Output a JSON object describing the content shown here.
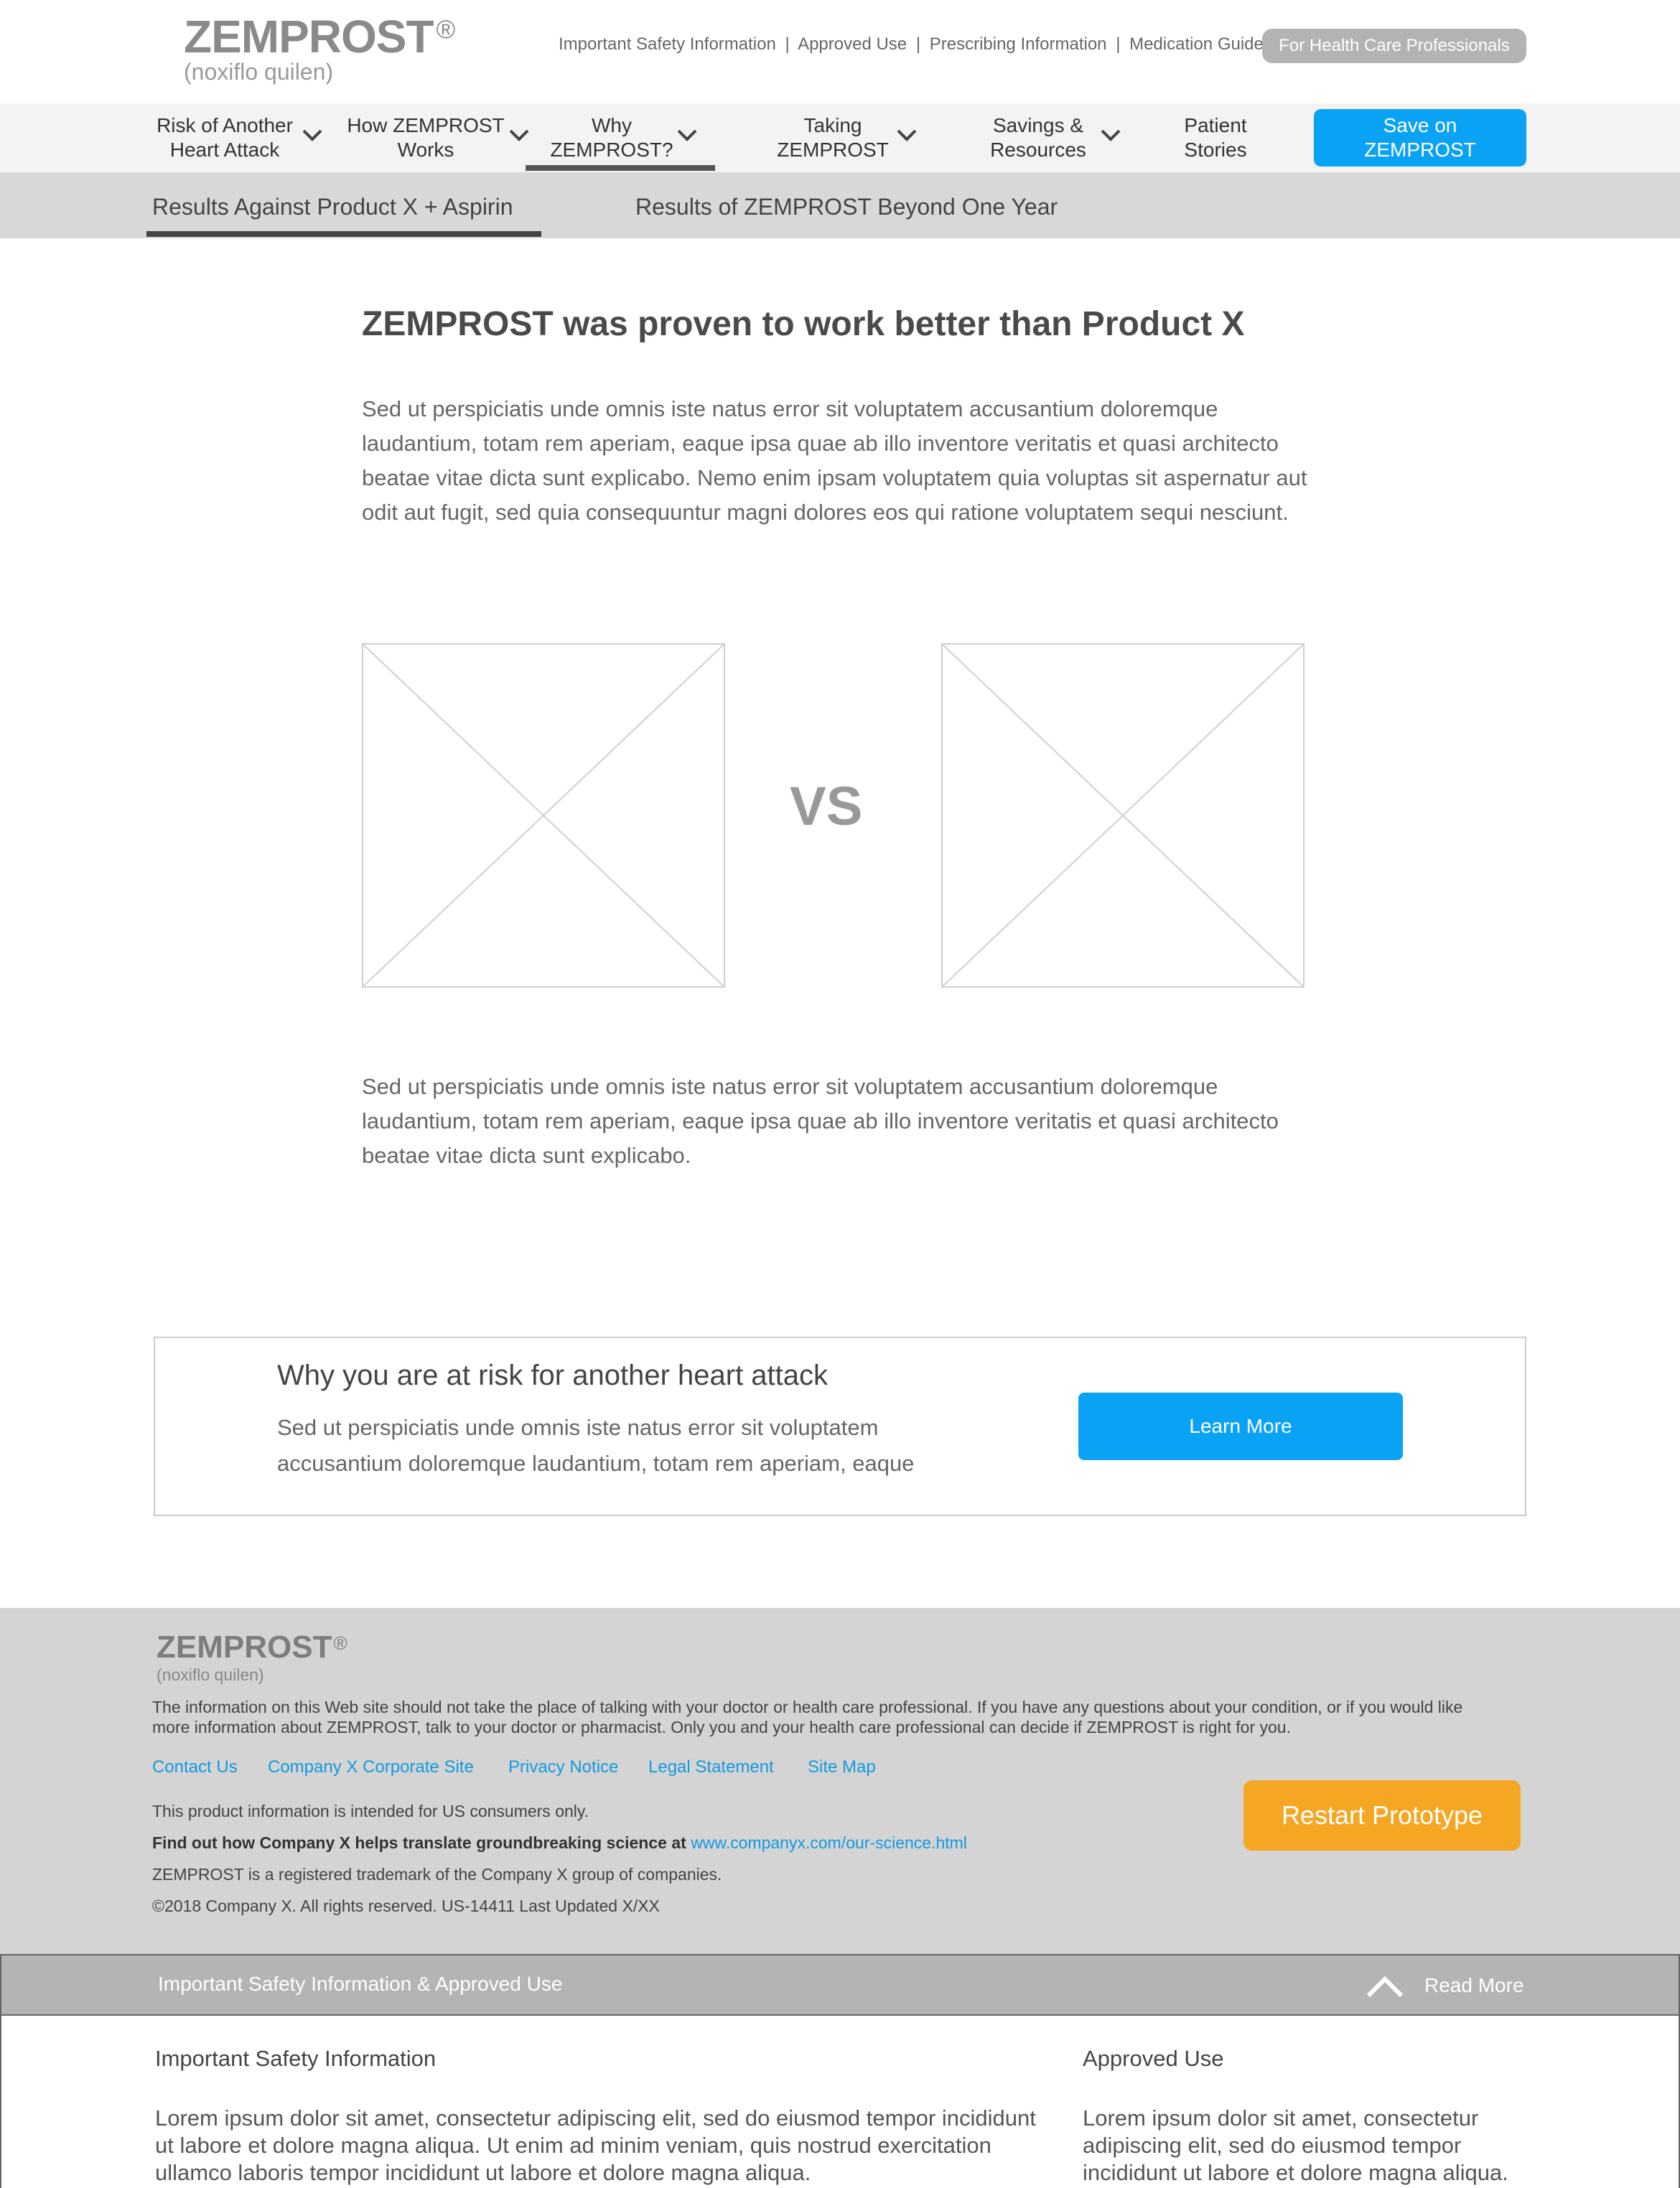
{
  "header": {
    "brand": "ZEMPROST",
    "brand_mark": "®",
    "brand_sub": "(noxiflo quilen)",
    "util_links": [
      "Important Safety Information",
      "Approved Use",
      "Prescribing Information",
      "Medication Guide"
    ],
    "util_sep": "|",
    "hcp_button": "For Health Care Professionals"
  },
  "nav": {
    "items": [
      {
        "line1": "Risk of Another",
        "line2": "Heart Attack"
      },
      {
        "line1": "How ZEMPROST",
        "line2": "Works"
      },
      {
        "line1": "Why",
        "line2": "ZEMPROST?"
      },
      {
        "line1": "Taking",
        "line2": "ZEMPROST"
      },
      {
        "line1": "Savings &",
        "line2": "Resources"
      },
      {
        "line1": "Patient",
        "line2": "Stories"
      }
    ],
    "save_line1": "Save on",
    "save_line2": "ZEMPROST"
  },
  "subnav": {
    "tabs": [
      "Results Against Product X  + Aspirin",
      "Results of ZEMPROST Beyond One Year"
    ]
  },
  "main": {
    "title": "ZEMPROST was proven to work better than Product X",
    "para1": "Sed ut perspiciatis unde omnis iste natus error sit voluptatem accusantium doloremque laudantium, totam rem aperiam, eaque ipsa quae ab illo inventore veritatis et quasi architecto beatae vitae dicta sunt explicabo. Nemo enim ipsam voluptatem quia voluptas sit aspernatur aut odit aut fugit, sed quia consequuntur magni dolores eos qui ratione voluptatem sequi nesciunt.",
    "vs": "VS",
    "para2": "Sed ut perspiciatis unde omnis iste natus error sit voluptatem accusantium doloremque laudantium, totam rem aperiam, eaque ipsa quae ab illo inventore veritatis et quasi architecto beatae vitae dicta sunt explicabo."
  },
  "cta": {
    "title": "Why you are at risk for another heart attack",
    "text": "Sed ut perspiciatis unde omnis iste natus error sit voluptatem accusantium doloremque laudantium, totam rem aperiam, eaque",
    "button": "Learn More"
  },
  "footer": {
    "brand": "ZEMPROST",
    "brand_mark": "®",
    "brand_sub": "(noxiflo quilen)",
    "disclaimer": "The information on this Web site should not take the place of talking with your doctor or health care professional. If you have any questions about your condition, or if you would like more information about ZEMPROST, talk to your doctor or pharmacist. Only you and your health care professional can decide if ZEMPROST is right for you.",
    "links": [
      "Contact Us",
      "Company X Corporate Site",
      "Privacy Notice",
      "Legal Statement",
      "Site Map"
    ],
    "us_only": "This product information is intended for US consumers only.",
    "science_bold": "Find out how Company X helps translate groundbreaking science at",
    "science_link": "www.companyx.com/our-science.html",
    "trademark": "ZEMPROST is a registered trademark of the Company X group of companies.",
    "copyright": "©2018 Company X. All rights reserved. US-14411 Last Updated X/XX",
    "restart": "Restart Prototype"
  },
  "isi": {
    "bar_title": "Important Safety Information & Approved Use",
    "read_more": "Read More",
    "col1_title": "Important Safety Information",
    "col1_text": "Lorem ipsum dolor sit amet, consectetur adipiscing elit, sed do eiusmod tempor incididunt ut labore et dolore magna aliqua. Ut enim ad minim veniam, quis nostrud exercitation ullamco laboris tempor incididunt ut labore et dolore magna aliqua.",
    "col2_title": "Approved Use",
    "col2_text": "Lorem ipsum dolor sit amet, consectetur adipiscing elit, sed do eiusmod tempor incididunt ut labore et dolore magna aliqua."
  },
  "colors": {
    "primary_blue": "#0aa2f5",
    "restart_orange": "#f5a623",
    "link_blue": "#139ae0"
  }
}
